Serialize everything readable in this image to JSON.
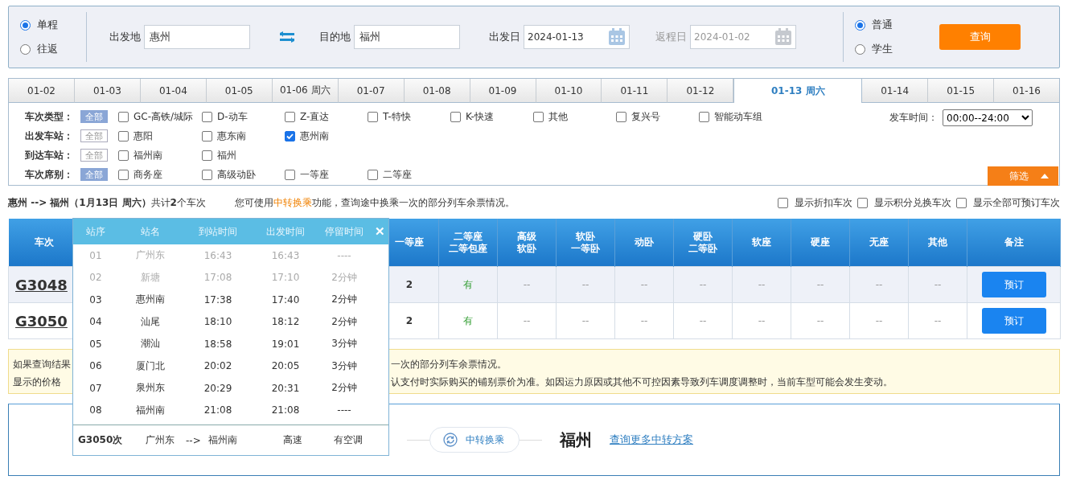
{
  "search": {
    "trip_types": [
      {
        "label": "单程",
        "selected": true
      },
      {
        "label": "往返",
        "selected": false
      }
    ],
    "from": {
      "label": "出发地",
      "value": "惠州"
    },
    "to": {
      "label": "目的地",
      "value": "福州"
    },
    "depart_date": {
      "label": "出发日",
      "value": "2024-01-13",
      "disabled": false
    },
    "return_date": {
      "label": "返程日",
      "value": "2024-01-02",
      "disabled": true
    },
    "passenger_types": [
      {
        "label": "普通",
        "selected": true
      },
      {
        "label": "学生",
        "selected": false
      }
    ],
    "query_button": "查询"
  },
  "date_tabs": [
    {
      "label": "01-02",
      "selected": false
    },
    {
      "label": "01-03",
      "selected": false
    },
    {
      "label": "01-04",
      "selected": false
    },
    {
      "label": "01-05",
      "selected": false
    },
    {
      "label": "01-06 周六",
      "selected": false
    },
    {
      "label": "01-07",
      "selected": false
    },
    {
      "label": "01-08",
      "selected": false
    },
    {
      "label": "01-09",
      "selected": false
    },
    {
      "label": "01-10",
      "selected": false
    },
    {
      "label": "01-11",
      "selected": false
    },
    {
      "label": "01-12",
      "selected": false
    },
    {
      "label": "01-13 周六",
      "selected": true
    },
    {
      "label": "01-14",
      "selected": false
    },
    {
      "label": "01-15",
      "selected": false
    },
    {
      "label": "01-16",
      "selected": false
    }
  ],
  "filters": [
    {
      "label": "车次类型：",
      "all": {
        "label": "全部",
        "selected": true
      },
      "options": [
        {
          "label": "GC-高铁/城际",
          "checked": false
        },
        {
          "label": "D-动车",
          "checked": false
        },
        {
          "label": "Z-直达",
          "checked": false
        },
        {
          "label": "T-特快",
          "checked": false
        },
        {
          "label": "K-快速",
          "checked": false
        },
        {
          "label": "其他",
          "checked": false
        },
        {
          "label": "复兴号",
          "checked": false
        },
        {
          "label": "智能动车组",
          "checked": false
        }
      ]
    },
    {
      "label": "出发车站：",
      "all": {
        "label": "全部",
        "selected": false
      },
      "options": [
        {
          "label": "惠阳",
          "checked": false
        },
        {
          "label": "惠东南",
          "checked": false
        },
        {
          "label": "惠州南",
          "checked": true
        }
      ]
    },
    {
      "label": "到达车站：",
      "all": {
        "label": "全部",
        "selected": false
      },
      "options": [
        {
          "label": "福州南",
          "checked": false
        },
        {
          "label": "福州",
          "checked": false
        }
      ]
    },
    {
      "label": "车次席别：",
      "all": {
        "label": "全部",
        "selected": true
      },
      "options": [
        {
          "label": "商务座",
          "checked": false
        },
        {
          "label": "高级动卧",
          "checked": false
        },
        {
          "label": "一等座",
          "checked": false
        },
        {
          "label": "二等座",
          "checked": false
        }
      ]
    }
  ],
  "depart_time": {
    "label": "发车时间：",
    "value": "00:00--24:00"
  },
  "filter_toggle": "筛选",
  "summary": "**惠州 --> 福州（1月13日  周六）**共计**2**个车次",
  "transfer_hint": "您可使用**中转换乘**功能，查询途中换乘一次的部分列车余票情况。",
  "display_options": [
    {
      "label": "显示折扣车次",
      "checked": false
    },
    {
      "label": "显示积分兑换车次",
      "checked": false
    },
    {
      "label": "显示全部可预订车次",
      "checked": false
    }
  ],
  "table": {
    "columns": [
      {
        "label": "车次"
      },
      {},
      {
        "label": "一等座"
      },
      {
        "label": "二等座",
        "sublabel": "二等包座"
      },
      {
        "label": "高级",
        "sublabel": "软卧"
      },
      {
        "label": "软卧",
        "sublabel": "一等卧"
      },
      {
        "label": "动卧"
      },
      {
        "label": "硬卧",
        "sublabel": "二等卧"
      },
      {
        "label": "软座"
      },
      {
        "label": "硬座"
      },
      {
        "label": "无座"
      },
      {
        "label": "其他"
      },
      {
        "label": "备注"
      }
    ],
    "rows": [
      {
        "cells": [
          "G3048",
          "",
          "2",
          "有",
          "--",
          "--",
          "--",
          "--",
          "--",
          "--",
          "--",
          "--"
        ],
        "button": "预订"
      },
      {
        "cells": [
          "G3050",
          "",
          "2",
          "有",
          "--",
          "--",
          "--",
          "--",
          "--",
          "--",
          "--",
          "--"
        ],
        "button": "预订"
      }
    ]
  },
  "stop_popup": {
    "columns": [
      "站序",
      "站名",
      "到站时间",
      "出发时间",
      "停留时间"
    ],
    "close": "✕",
    "stops": [
      [
        "01",
        "广州东",
        "16:43",
        "16:43",
        "----",
        true
      ],
      [
        "02",
        "新塘",
        "17:08",
        "17:10",
        "2分钟",
        true
      ],
      [
        "03",
        "惠州南",
        "17:38",
        "17:40",
        "2分钟",
        false
      ],
      [
        "04",
        "汕尾",
        "18:10",
        "18:12",
        "2分钟",
        false
      ],
      [
        "05",
        "潮汕",
        "18:58",
        "19:01",
        "3分钟",
        false
      ],
      [
        "06",
        "厦门北",
        "20:02",
        "20:05",
        "3分钟",
        false
      ],
      [
        "07",
        "泉州东",
        "20:29",
        "20:31",
        "2分钟",
        false
      ],
      [
        "08",
        "福州南",
        "21:08",
        "21:08",
        "----",
        false
      ]
    ],
    "footer": {
      "train": "G3050次",
      "from": "广州东",
      "arrow": "-->",
      "to": "福州南",
      "type": "高速",
      "ac": "有空调"
    }
  },
  "notice": [
    {
      "left": "如果查询结果",
      "right": "一次的部分列车余票情况。"
    },
    {
      "left": "显示的价格",
      "right": "认支付时实际购买的铺别票价为准。如因运力原因或其他不可控因素导致列车调度调整时，当前车型可能会发生变动。"
    }
  ],
  "transfer": {
    "button": "中转换乘",
    "city": "福州",
    "link": "查询更多中转方案"
  }
}
